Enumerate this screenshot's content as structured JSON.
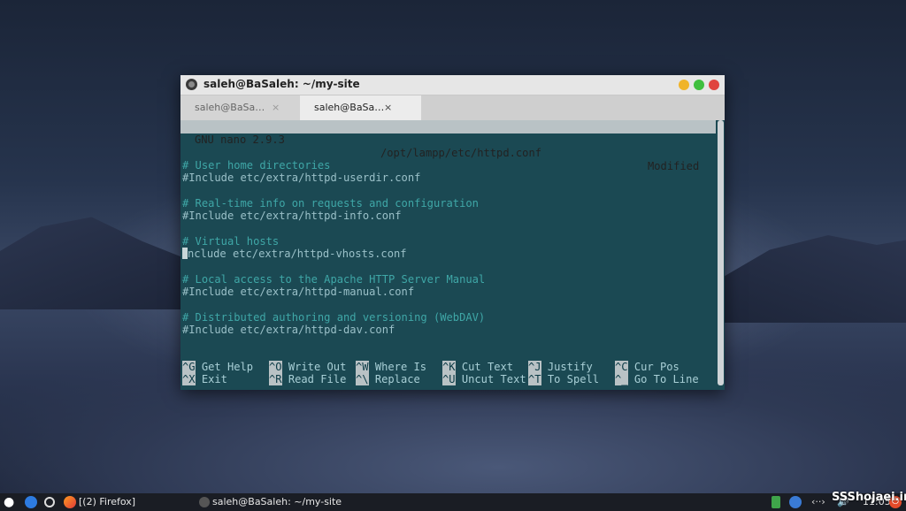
{
  "window": {
    "title": "saleh@BaSaleh: ~/my-site",
    "tabs": [
      {
        "label": "saleh@BaSa…",
        "close": "×"
      },
      {
        "label": "saleh@BaSa…",
        "close": "×"
      }
    ]
  },
  "nano": {
    "version": "GNU nano 2.9.3",
    "file": "/opt/lampp/etc/httpd.conf",
    "status": "Modified",
    "lines": [
      "# User home directories",
      "#Include etc/extra/httpd-userdir.conf",
      "# Real-time info on requests and configuration",
      "#Include etc/extra/httpd-info.conf",
      "# Virtual hosts",
      "Include etc/extra/httpd-vhosts.conf",
      "# Local access to the Apache HTTP Server Manual",
      "#Include etc/extra/httpd-manual.conf",
      "# Distributed authoring and versioning (WebDAV)",
      "#Include etc/extra/httpd-dav.conf"
    ],
    "help": [
      [
        {
          "key": "^G",
          "desc": "Get Help"
        },
        {
          "key": "^O",
          "desc": "Write Out"
        },
        {
          "key": "^W",
          "desc": "Where Is"
        },
        {
          "key": "^K",
          "desc": "Cut Text"
        },
        {
          "key": "^J",
          "desc": "Justify"
        },
        {
          "key": "^C",
          "desc": "Cur Pos"
        }
      ],
      [
        {
          "key": "^X",
          "desc": "Exit"
        },
        {
          "key": "^R",
          "desc": "Read File"
        },
        {
          "key": "^\\",
          "desc": "Replace"
        },
        {
          "key": "^U",
          "desc": "Uncut Text"
        },
        {
          "key": "^T",
          "desc": "To Spell"
        },
        {
          "key": "^_",
          "desc": "Go To Line"
        }
      ]
    ]
  },
  "taskbar": {
    "firefox_label": "[(2) Firefox]",
    "terminal_label": "saleh@BaSaleh: ~/my-site",
    "clock": "11:05",
    "tray_network": "‹··›",
    "tray_volume": "🔊"
  },
  "watermark": "SSShojaei.ir"
}
